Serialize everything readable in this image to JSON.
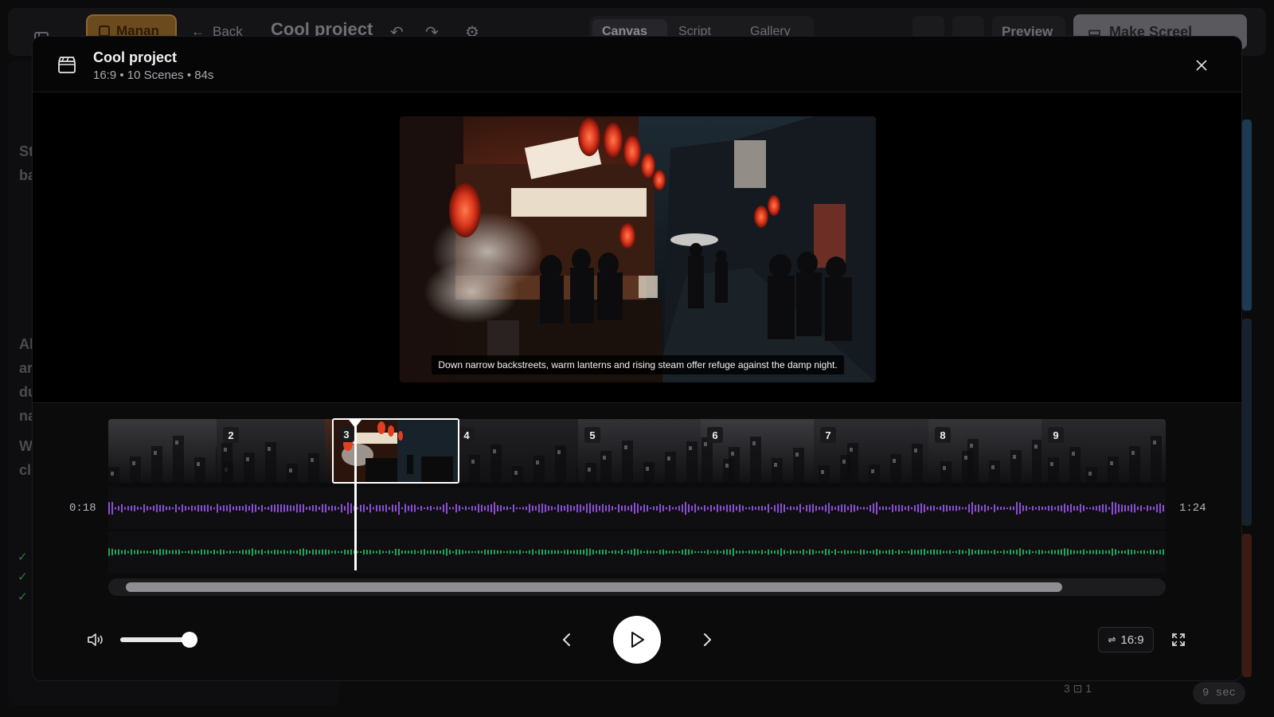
{
  "background": {
    "brand_label": "Manan",
    "back_label": "Back",
    "project_title": "Cool project",
    "tabs": [
      {
        "label": "Canvas"
      },
      {
        "label": "Script"
      },
      {
        "label": "Gallery"
      }
    ],
    "preview_label": "Preview",
    "make_label": "Make Screel",
    "bottom_info": "3   ⊡ 1",
    "duration_chip": "9 sec"
  },
  "modal": {
    "title": "Cool project",
    "subtitle": "16:9 • 10 Scenes • 84s",
    "caption": "Down narrow backstreets, warm lanterns and rising steam offer refuge against the damp night.",
    "current_time": "0:18",
    "total_time": "1:24",
    "aspect_label": "16:9",
    "volume_level": 0.9,
    "scroll_position": 0.02,
    "scenes": [
      {
        "number": ""
      },
      {
        "number": "2"
      },
      {
        "number": "3"
      },
      {
        "number": "4"
      },
      {
        "number": "5"
      },
      {
        "number": "6"
      },
      {
        "number": "7"
      },
      {
        "number": "8"
      },
      {
        "number": "9"
      }
    ],
    "selected_scene": "3"
  },
  "colors": {
    "voice_wave": "#8a4fd6",
    "music_wave": "#22a35a",
    "brand": "#6b4a1e"
  }
}
